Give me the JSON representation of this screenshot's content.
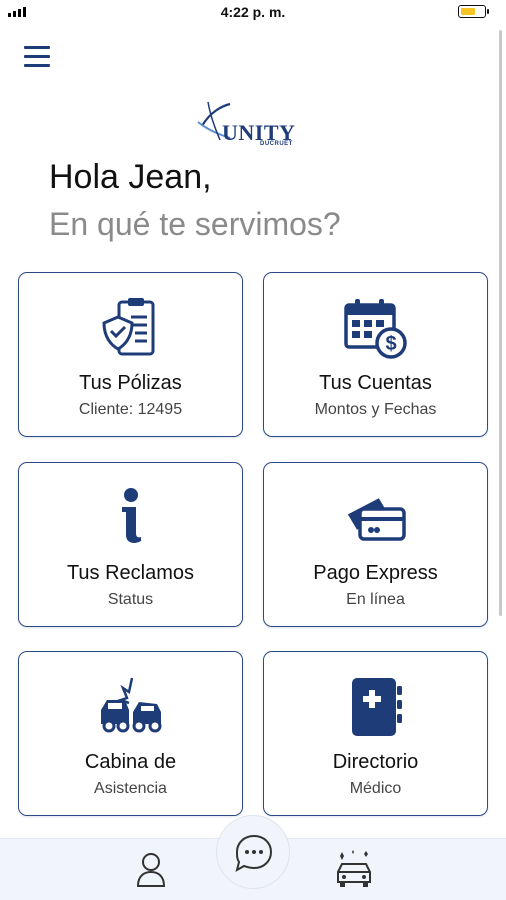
{
  "status_bar": {
    "time": "4:22 p. m."
  },
  "header": {
    "menu_icon": "hamburger-menu-icon"
  },
  "logo": {
    "brand": "UNITY",
    "sub": "DUCRUET"
  },
  "greeting": {
    "line1": "Hola Jean,",
    "line2": "En qué te servimos?"
  },
  "cards": [
    {
      "title": "Tus Pólizas",
      "subtitle": "Cliente: 12495",
      "icon": "policy-shield-icon"
    },
    {
      "title": "Tus Cuentas",
      "subtitle": "Montos y Fechas",
      "icon": "calendar-dollar-icon"
    },
    {
      "title": "Tus Reclamos",
      "subtitle": "Status",
      "icon": "info-icon"
    },
    {
      "title": "Pago Express",
      "subtitle": "En línea",
      "icon": "credit-card-icon"
    },
    {
      "title": "Cabina de",
      "subtitle": "Asistencia",
      "icon": "car-crash-icon"
    },
    {
      "title": "Directorio",
      "subtitle": "Médico",
      "icon": "medical-directory-icon"
    }
  ],
  "bottom_nav": {
    "items": [
      "user-profile-icon",
      "chat-bubble-icon",
      "car-service-icon"
    ]
  },
  "colors": {
    "primary": "#1e3c78",
    "border": "#2d4a88",
    "battery": "#f6c524",
    "bottom_bar": "#f1f4fa",
    "subtext": "#8a8a8a"
  }
}
